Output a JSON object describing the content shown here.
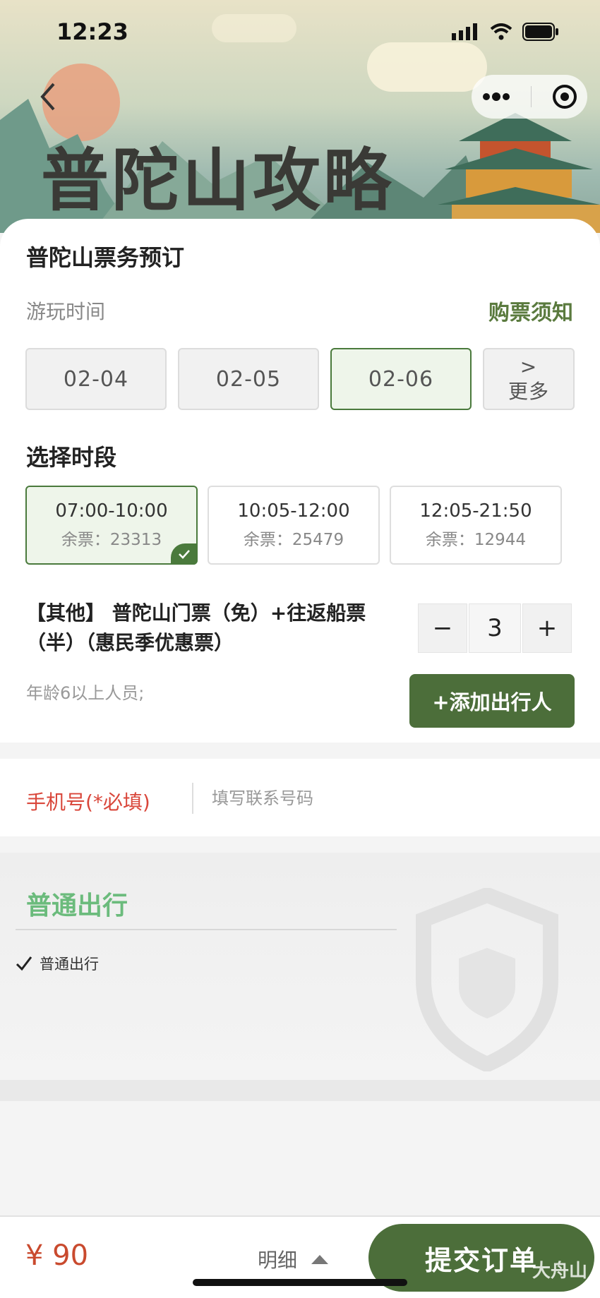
{
  "status_bar": {
    "time": "12:23"
  },
  "banner": {
    "title": "普陀山攻略"
  },
  "card": {
    "title": "普陀山票务预订",
    "play_time_label": "游玩时间",
    "notice_link": "购票须知",
    "dates": [
      {
        "label": "02-04",
        "selected": false
      },
      {
        "label": "02-05",
        "selected": false
      },
      {
        "label": "02-06",
        "selected": true
      }
    ],
    "more": {
      "arrow": ">",
      "label": "更多"
    },
    "slot_section_label": "选择时段",
    "slots": [
      {
        "time": "07:00-10:00",
        "remaining": "余票：23313",
        "selected": true
      },
      {
        "time": "10:05-12:00",
        "remaining": "余票：25479",
        "selected": false
      },
      {
        "time": "12:05-21:50",
        "remaining": "余票：12944",
        "selected": false
      }
    ],
    "ticket_name": "【其他】 普陀山门票（免）+往返船票（半）（惠民季优惠票）",
    "quantity": "3",
    "minus": "−",
    "plus": "+",
    "age_note": "年龄6以上人员;",
    "add_traveler": "+添加出行人"
  },
  "phone": {
    "label": "手机号(*必填)",
    "placeholder": "填写联系号码"
  },
  "travel": {
    "title": "普通出行",
    "option": "普通出行"
  },
  "bottom_bar": {
    "price": "¥ 90",
    "detail": "明细",
    "submit": "提交订单"
  },
  "watermark": "大舟山",
  "colors": {
    "accent_green": "#4c6e3a",
    "selected_bg": "#eef5ea",
    "required_red": "#d9463a",
    "price_red": "#c94a2e",
    "travel_green": "#6bbb7c"
  }
}
